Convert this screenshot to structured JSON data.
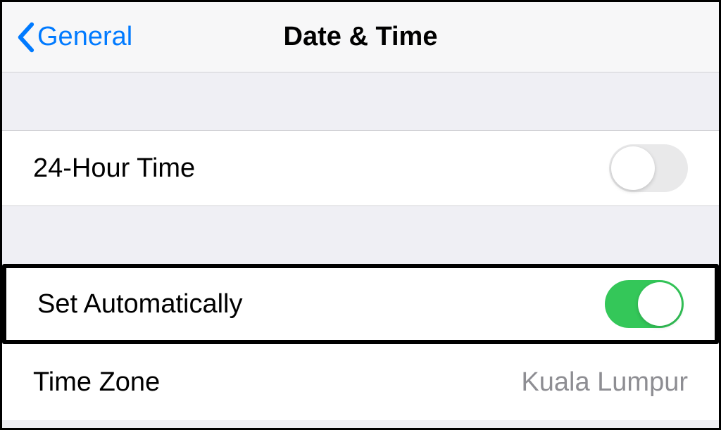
{
  "navbar": {
    "back_label": "General",
    "title": "Date & Time"
  },
  "rows": {
    "twenty_four_hour": {
      "label": "24-Hour Time",
      "enabled": false
    },
    "set_automatically": {
      "label": "Set Automatically",
      "enabled": true
    },
    "time_zone": {
      "label": "Time Zone",
      "value": "Kuala Lumpur"
    }
  }
}
